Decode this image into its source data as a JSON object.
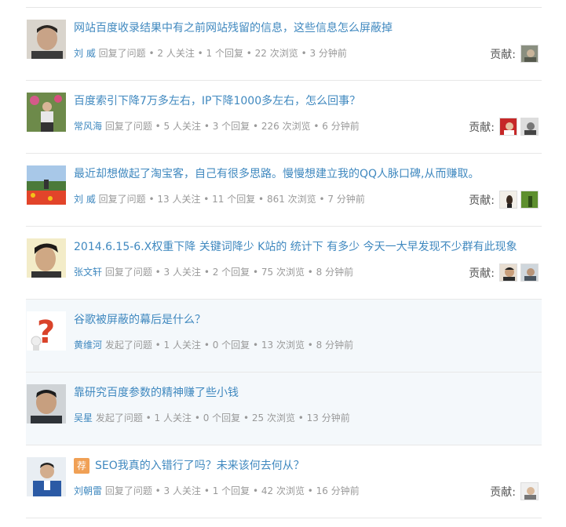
{
  "contrib_label": "贡献:",
  "items": [
    {
      "title": "网站百度收录结果中有之前网站残留的信息，这些信息怎么屏蔽掉",
      "user": "刘 威",
      "meta": "回复了问题 • 2 人关注 • 1 个回复 • 22 次浏览 • 3 分钟前",
      "shaded": false,
      "recommended": false
    },
    {
      "title": "百度索引下降7万多左右，IP下降1000多左右，怎么回事？",
      "user": "常风海",
      "meta": "回复了问题 • 5 人关注 • 3 个回复 • 226 次浏览 • 6 分钟前",
      "shaded": false,
      "recommended": false
    },
    {
      "title": "最近却想做起了淘宝客，自己有很多思路。慢慢想建立我的QQ人脉口碑,从而赚取。",
      "user": "刘 威",
      "meta": "回复了问题 • 13 人关注 • 11 个回复 • 861 次浏览 • 7 分钟前",
      "shaded": false,
      "recommended": false
    },
    {
      "title": "2014.6.15-6.X权重下降 关键词降少 K站的 统计下 有多少 今天一大早发现不少群有此现象",
      "user": "张文轩",
      "meta": "回复了问题 • 3 人关注 • 2 个回复 • 75 次浏览 • 8 分钟前",
      "shaded": false,
      "recommended": false
    },
    {
      "title": "谷歌被屏蔽的幕后是什么？",
      "user": "黄维河",
      "meta": "发起了问题 • 1 人关注 • 0 个回复 • 13 次浏览 • 8 分钟前",
      "shaded": true,
      "recommended": false
    },
    {
      "title": "靠研究百度参数的精神赚了些小钱",
      "user": "吴星",
      "meta": "发起了问题 • 1 人关注 • 0 个回复 • 25 次浏览 • 13 分钟前",
      "shaded": true,
      "recommended": false
    },
    {
      "title": "SEO我真的入错行了吗？未来该何去何从？",
      "user": "刘朝雷",
      "meta": "回复了问题 • 3 人关注 • 1 个回复 • 42 次浏览 • 16 分钟前",
      "shaded": false,
      "recommended": true,
      "badge": "荐"
    }
  ]
}
